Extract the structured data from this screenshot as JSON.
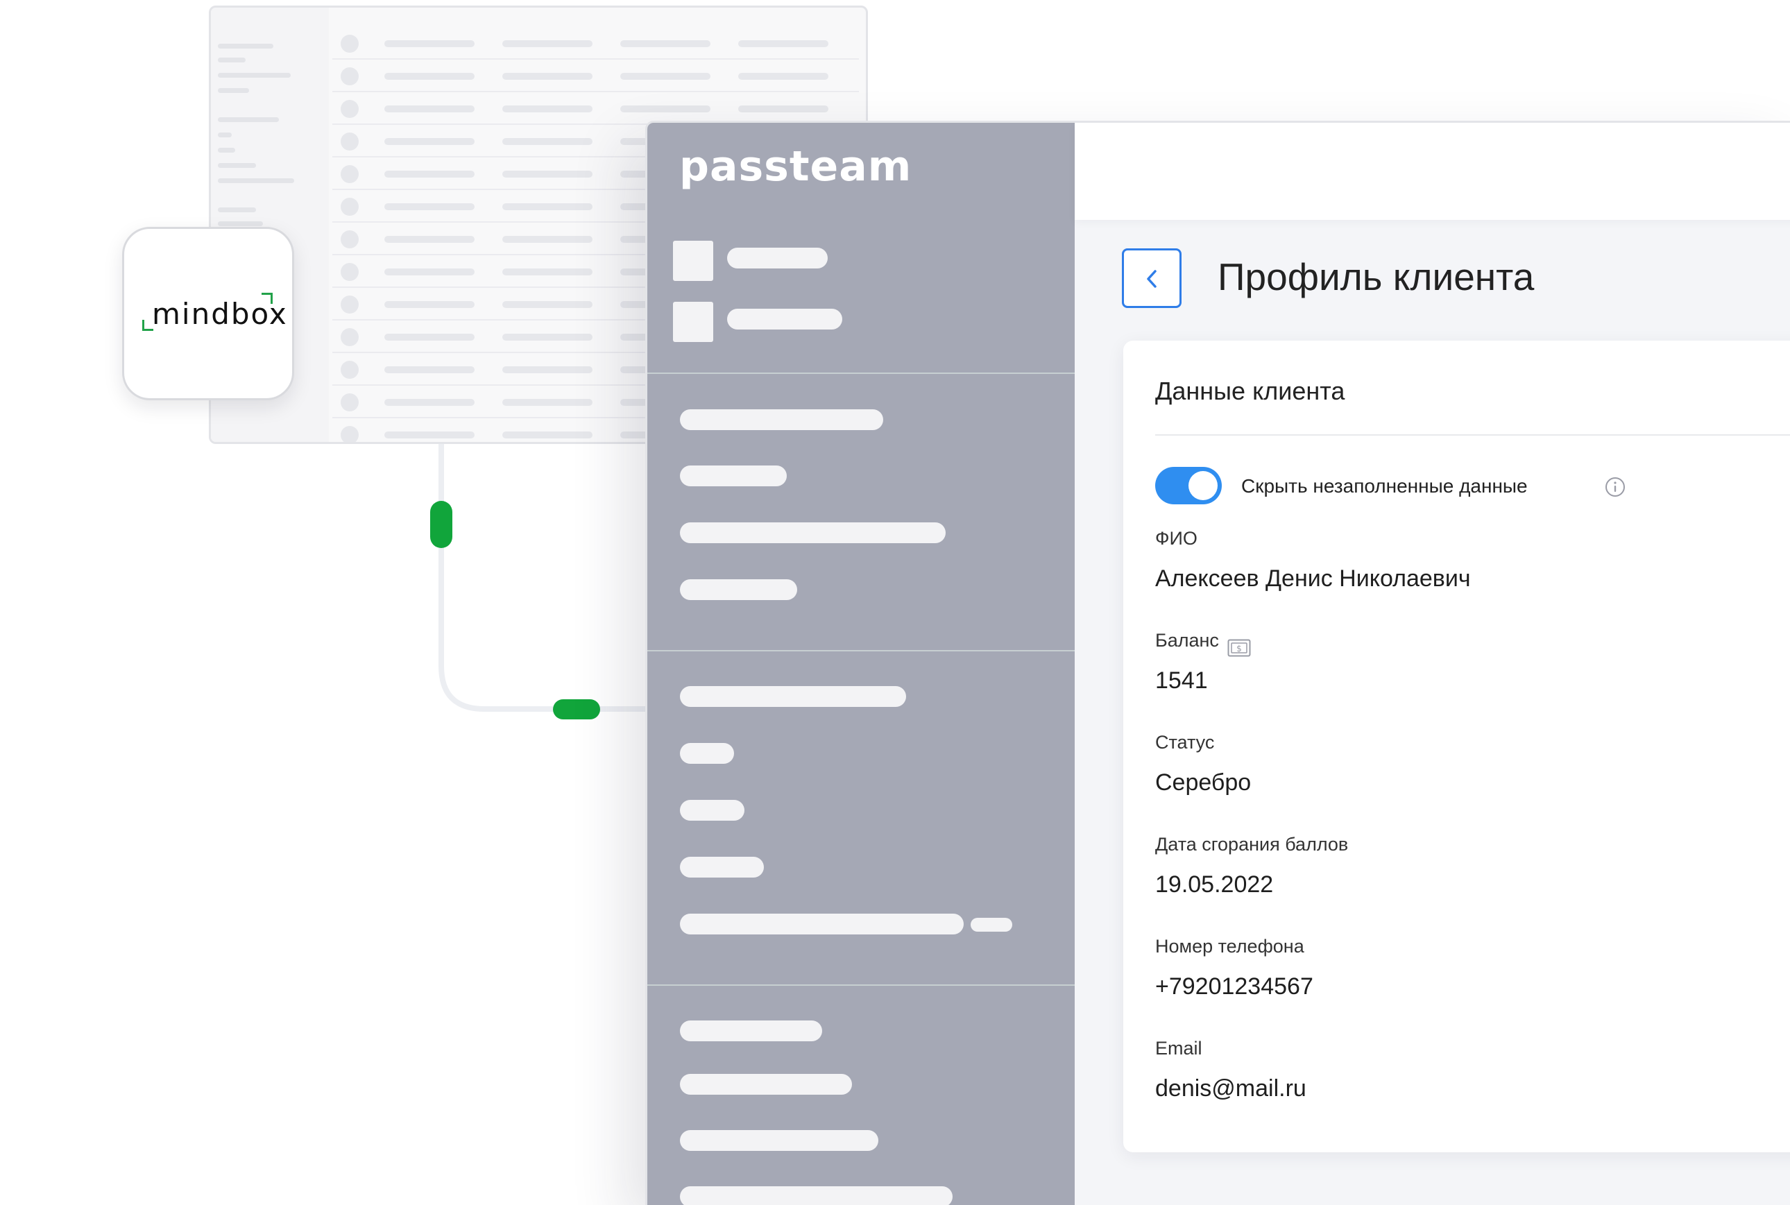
{
  "mindbox": {
    "logo_text": "mindbox",
    "accent_color": "#22a24a"
  },
  "passteam": {
    "logo_text": "passteam",
    "sidebar_color": "#a5a8b5"
  },
  "page": {
    "title": "Профиль клиента",
    "back_icon": "chevron-left-icon",
    "accent_color": "#2f7de8"
  },
  "card": {
    "title": "Данные клиента",
    "hide_empty_toggle": {
      "label": "Скрыть незаполненные данные",
      "on": true,
      "icon": "info-icon"
    },
    "fields": [
      {
        "label": "ФИО",
        "value": "Алексеев Денис Николаевич"
      },
      {
        "label": "Баланс",
        "value": "1541",
        "icon": "currency-icon"
      },
      {
        "label": "Статус",
        "value": "Серебро"
      },
      {
        "label": "Дата сгорания баллов",
        "value": "19.05.2022"
      },
      {
        "label": "Номер телефона",
        "value": "+79201234567"
      },
      {
        "label": "Email",
        "value": "denis@mail.ru"
      }
    ]
  }
}
